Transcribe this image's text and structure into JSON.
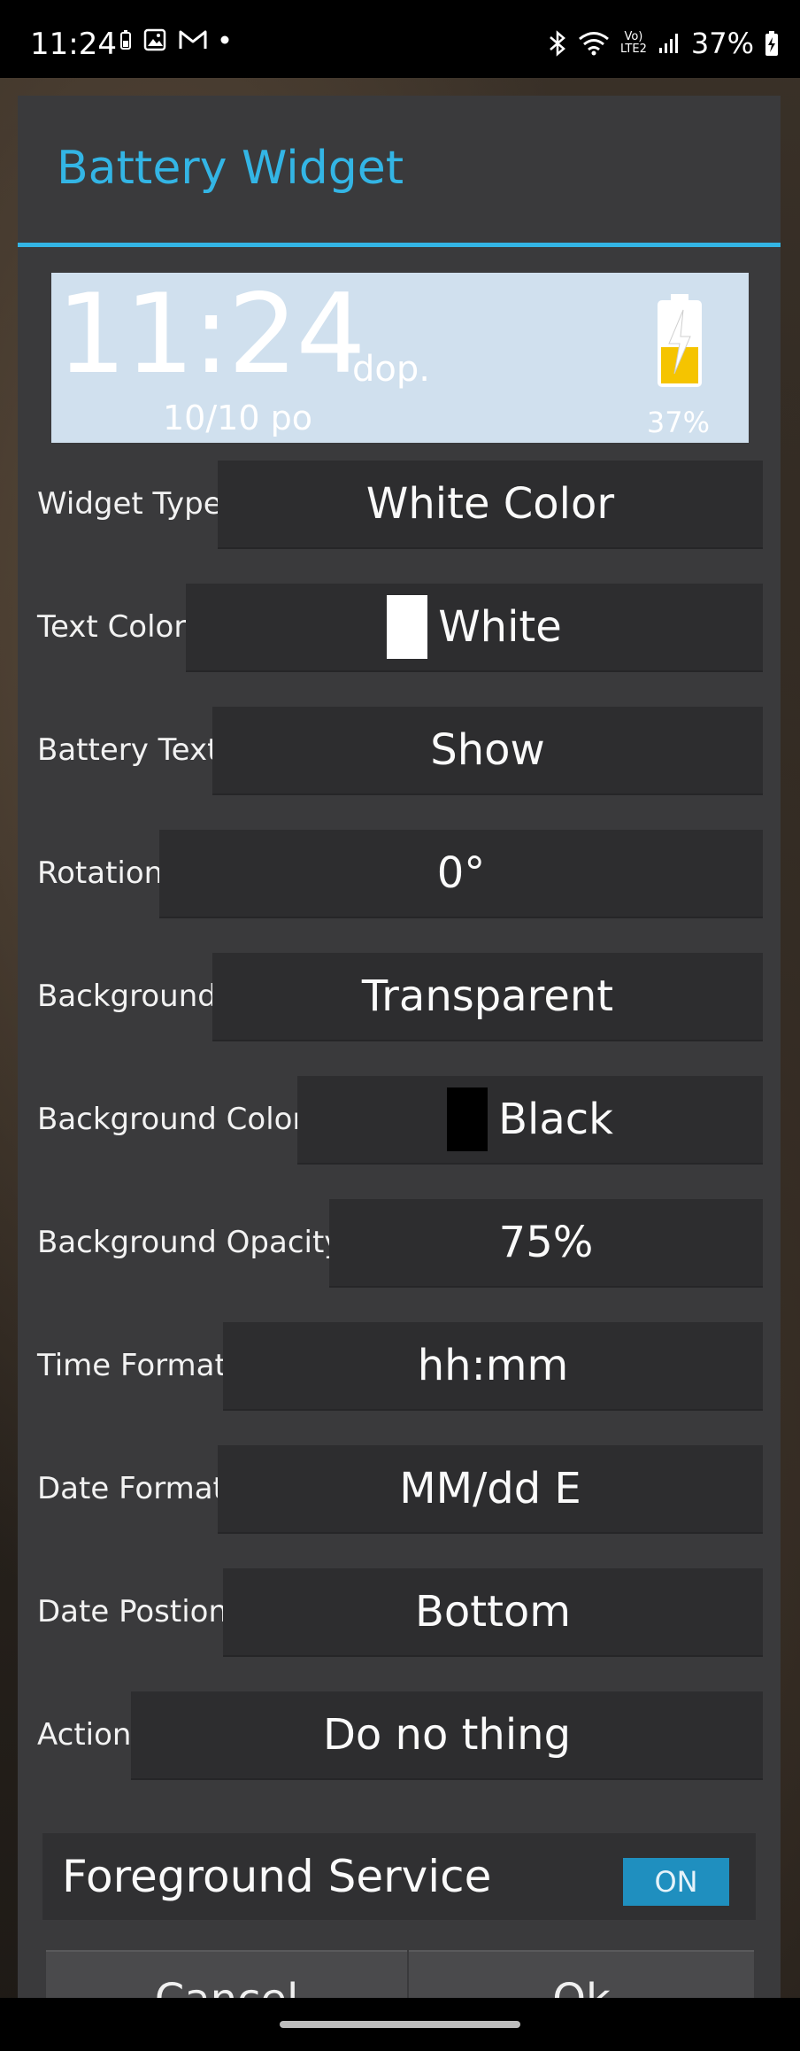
{
  "status_bar": {
    "time": "11:24",
    "battery_percent": "37%",
    "network_label": "LTE2",
    "icons": [
      "battery-small-icon",
      "image-icon",
      "gmail-icon",
      "dot-icon",
      "bluetooth-icon",
      "wifi-icon",
      "volte-icon",
      "signal-icon",
      "battery-charging-icon"
    ]
  },
  "dialog": {
    "title": "Battery Widget",
    "accent_color": "#33b5e5"
  },
  "preview": {
    "time": "11:24",
    "ampm": "dop.",
    "date": "10/10 po",
    "battery_percent": "37%",
    "battery_level": 0.37,
    "background_color": "#d0e0ee"
  },
  "settings": [
    {
      "label": "Widget Type",
      "value": "White Color"
    },
    {
      "label": "Text Color",
      "value": "White",
      "swatch": "#ffffff"
    },
    {
      "label": "Battery Text",
      "value": "Show"
    },
    {
      "label": "Rotation",
      "value": "0°"
    },
    {
      "label": "Background",
      "value": "Transparent"
    },
    {
      "label": "Background Color",
      "value": "Black",
      "swatch": "#000000"
    },
    {
      "label": "Background Opacity",
      "value": "75%"
    },
    {
      "label": "Time Format",
      "value": "hh:mm"
    },
    {
      "label": "Date Format",
      "value": "MM/dd E"
    },
    {
      "label": "Date Postion",
      "value": "Bottom"
    },
    {
      "label": "Action",
      "value": "Do no thing"
    }
  ],
  "foreground_service": {
    "label": "Foreground Service",
    "toggle": "ON"
  },
  "buttons": {
    "cancel": "Cancel",
    "ok": "Ok"
  }
}
